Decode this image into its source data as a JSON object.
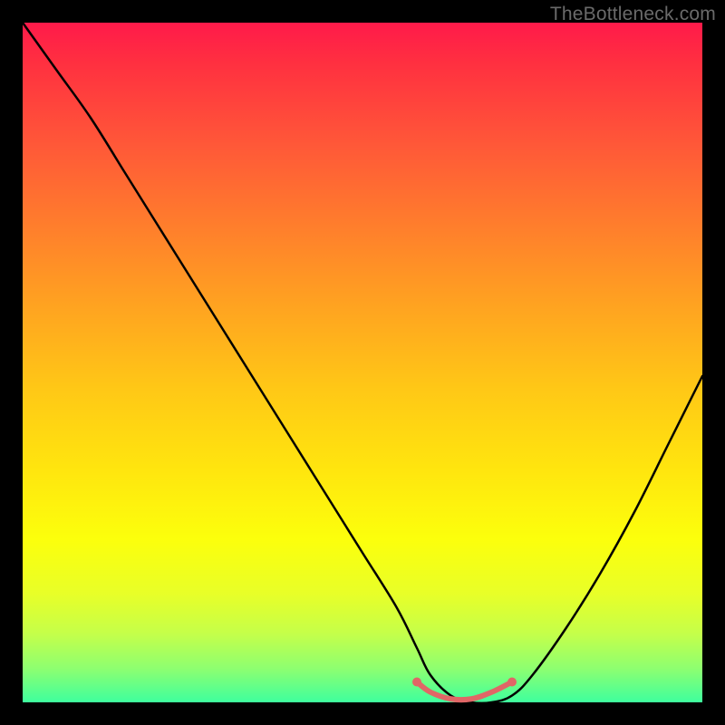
{
  "watermark": "TheBottleneck.com",
  "chart_data": {
    "type": "line",
    "title": "",
    "xlabel": "",
    "ylabel": "",
    "xlim": [
      0,
      100
    ],
    "ylim": [
      0,
      100
    ],
    "grid": false,
    "legend": false,
    "background_gradient": {
      "top": "#ff1a4a",
      "bottom": "#3eff9e",
      "note": "vertical rainbow gradient red→orange→yellow→green, overlaid on black frame"
    },
    "series": [
      {
        "name": "bottleneck-curve",
        "color": "#000000",
        "stroke_width": 2.5,
        "x": [
          0,
          5,
          10,
          15,
          20,
          25,
          30,
          35,
          40,
          45,
          50,
          55,
          58,
          60,
          63,
          66,
          69,
          72,
          75,
          80,
          85,
          90,
          95,
          100
        ],
        "values": [
          100,
          93,
          86,
          78,
          70,
          62,
          54,
          46,
          38,
          30,
          22,
          14,
          8,
          4,
          1,
          0,
          0,
          1,
          4,
          11,
          19,
          28,
          38,
          48
        ]
      },
      {
        "name": "highlight-flat-segment",
        "color": "#e06666",
        "stroke_width": 6,
        "x": [
          58,
          60,
          63,
          66,
          69,
          72
        ],
        "values": [
          3,
          1.5,
          0.5,
          0.5,
          1.5,
          3
        ]
      }
    ],
    "markers": [
      {
        "name": "left-end-dot",
        "x": 58,
        "y": 3,
        "color": "#e06666",
        "r": 5
      },
      {
        "name": "right-end-dot",
        "x": 72,
        "y": 3,
        "color": "#e06666",
        "r": 5
      }
    ]
  }
}
